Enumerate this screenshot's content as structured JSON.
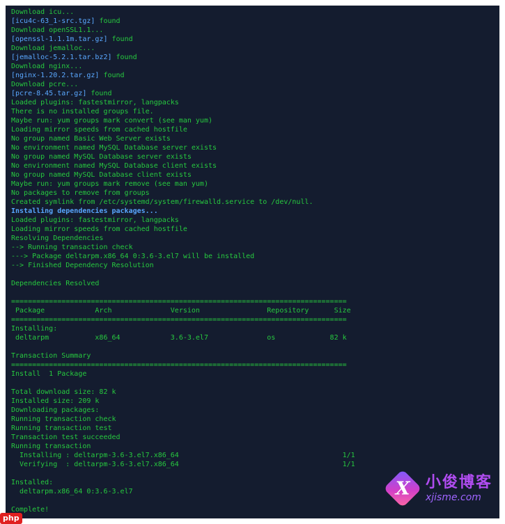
{
  "terminal": {
    "lines": [
      {
        "text": "Download icu...",
        "style": "normal"
      },
      {
        "text": "[icu4c-63_1-src.tgz] found",
        "style": "link"
      },
      {
        "text": "Download openSSL1.1...",
        "style": "normal"
      },
      {
        "text": "[openssl-1.1.1m.tar.gz] found",
        "style": "link"
      },
      {
        "text": "Download jemalloc...",
        "style": "normal"
      },
      {
        "text": "[jemalloc-5.2.1.tar.bz2] found",
        "style": "link"
      },
      {
        "text": "Download nginx...",
        "style": "normal"
      },
      {
        "text": "[nginx-1.20.2.tar.gz] found",
        "style": "link"
      },
      {
        "text": "Download pcre...",
        "style": "normal"
      },
      {
        "text": "[pcre-8.45.tar.gz] found",
        "style": "link"
      },
      {
        "text": "Loaded plugins: fastestmirror, langpacks",
        "style": "normal"
      },
      {
        "text": "There is no installed groups file.",
        "style": "normal"
      },
      {
        "text": "Maybe run: yum groups mark convert (see man yum)",
        "style": "normal"
      },
      {
        "text": "Loading mirror speeds from cached hostfile",
        "style": "normal"
      },
      {
        "text": "No group named Basic Web Server exists",
        "style": "normal"
      },
      {
        "text": "No environment named MySQL Database server exists",
        "style": "normal"
      },
      {
        "text": "No group named MySQL Database server exists",
        "style": "normal"
      },
      {
        "text": "No environment named MySQL Database client exists",
        "style": "normal"
      },
      {
        "text": "No group named MySQL Database client exists",
        "style": "normal"
      },
      {
        "text": "Maybe run: yum groups mark remove (see man yum)",
        "style": "normal"
      },
      {
        "text": "No packages to remove from groups",
        "style": "normal"
      },
      {
        "text": "Created symlink from /etc/systemd/system/firewalld.service to /dev/null.",
        "style": "normal"
      },
      {
        "text": "Installing dependencies packages...",
        "style": "bold"
      },
      {
        "text": "Loaded plugins: fastestmirror, langpacks",
        "style": "normal"
      },
      {
        "text": "Loading mirror speeds from cached hostfile",
        "style": "normal"
      },
      {
        "text": "Resolving Dependencies",
        "style": "normal"
      },
      {
        "text": "--> Running transaction check",
        "style": "normal"
      },
      {
        "text": "---> Package deltarpm.x86_64 0:3.6-3.el7 will be installed",
        "style": "normal"
      },
      {
        "text": "--> Finished Dependency Resolution",
        "style": "normal"
      },
      {
        "text": "",
        "style": "normal"
      },
      {
        "text": "Dependencies Resolved",
        "style": "normal"
      },
      {
        "text": "",
        "style": "normal"
      },
      {
        "text": "================================================================================",
        "style": "normal"
      },
      {
        "text": " Package            Arch              Version                Repository      Size",
        "style": "normal"
      },
      {
        "text": "================================================================================",
        "style": "normal"
      },
      {
        "text": "Installing:",
        "style": "normal"
      },
      {
        "text": " deltarpm           x86_64            3.6-3.el7              os             82 k",
        "style": "normal"
      },
      {
        "text": "",
        "style": "normal"
      },
      {
        "text": "Transaction Summary",
        "style": "normal"
      },
      {
        "text": "================================================================================",
        "style": "normal"
      },
      {
        "text": "Install  1 Package",
        "style": "normal"
      },
      {
        "text": "",
        "style": "normal"
      },
      {
        "text": "Total download size: 82 k",
        "style": "normal"
      },
      {
        "text": "Installed size: 209 k",
        "style": "normal"
      },
      {
        "text": "Downloading packages:",
        "style": "normal"
      },
      {
        "text": "Running transaction check",
        "style": "normal"
      },
      {
        "text": "Running transaction test",
        "style": "normal"
      },
      {
        "text": "Transaction test succeeded",
        "style": "normal"
      },
      {
        "text": "Running transaction",
        "style": "normal"
      },
      {
        "text": "  Installing : deltarpm-3.6-3.el7.x86_64                                       1/1",
        "style": "normal"
      },
      {
        "text": "  Verifying  : deltarpm-3.6-3.el7.x86_64                                       1/1",
        "style": "normal"
      },
      {
        "text": "",
        "style": "normal"
      },
      {
        "text": "Installed:",
        "style": "normal"
      },
      {
        "text": "  deltarpm.x86_64 0:3.6-3.el7",
        "style": "normal"
      },
      {
        "text": "",
        "style": "normal"
      },
      {
        "text": "Complete!",
        "style": "normal"
      }
    ]
  },
  "watermark": {
    "logo_letter": "X",
    "title": "小俊博客",
    "url": "xjisme.com"
  },
  "php_badge": "php",
  "colors": {
    "background": "#141c2f",
    "text": "#27c93f",
    "highlight": "#5aa8ff"
  }
}
